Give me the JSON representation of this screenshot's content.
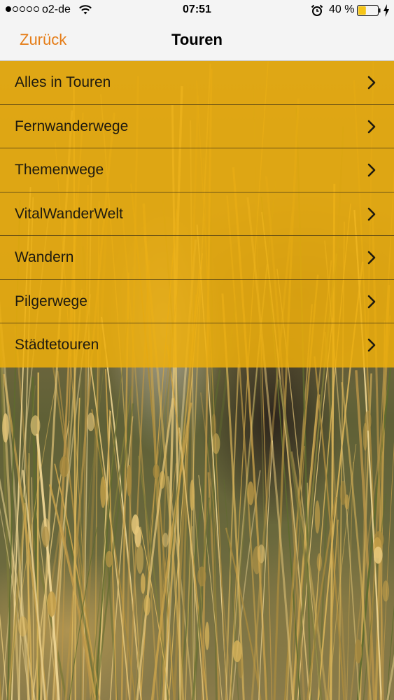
{
  "status_bar": {
    "signal_dots_filled": 1,
    "signal_dots_total": 5,
    "carrier": "o2-de",
    "wifi_icon": "wifi-icon",
    "time": "07:51",
    "alarm_icon": "alarm-clock-icon",
    "battery_percent": "40 %",
    "battery_level": 0.4,
    "battery_color": "#f5c518",
    "charging_icon": "bolt-icon"
  },
  "nav": {
    "back_label": "Zurück",
    "title": "Touren",
    "accent_color": "#e57c16"
  },
  "menu": {
    "background_color": "#eeaf0c",
    "chevron_icon": "chevron-right-icon",
    "items": [
      {
        "label": "Alles in Touren"
      },
      {
        "label": "Fernwanderwege"
      },
      {
        "label": "Themenwege"
      },
      {
        "label": "VitalWanderWelt"
      },
      {
        "label": "Wandern"
      },
      {
        "label": "Pilgerwege"
      },
      {
        "label": "Städtetouren"
      }
    ]
  }
}
